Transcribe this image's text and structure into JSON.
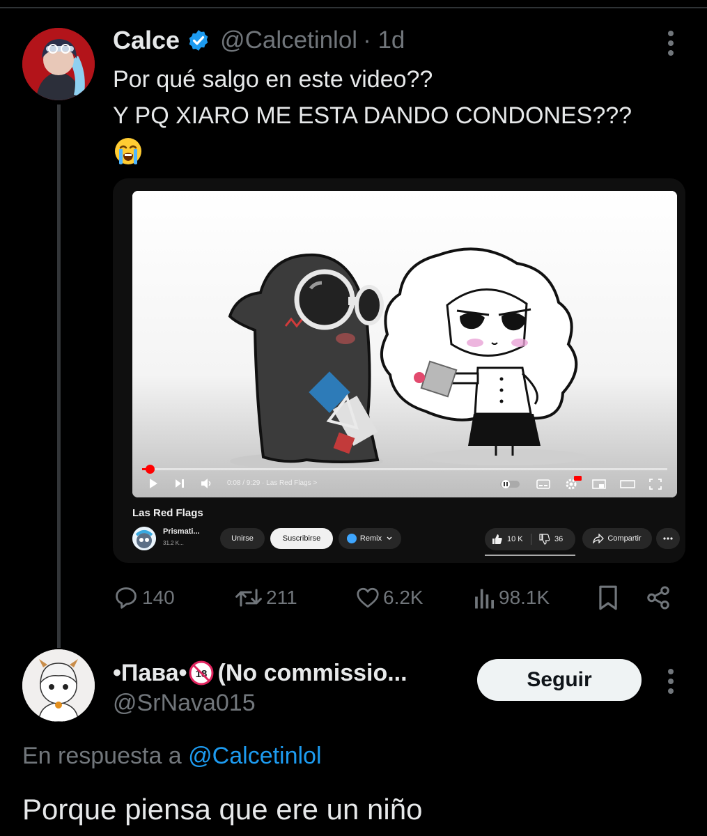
{
  "tweet": {
    "display_name": "Calce",
    "handle": "@Calcetinlol",
    "time": "· 1d",
    "line1": "Por qué salgo en este video??",
    "line2": "Y PQ XIARO ME ESTA DANDO CONDONES???",
    "emoji": "loudly-crying-face-emoji"
  },
  "video_card": {
    "title": "Las Red Flags",
    "time_display": "0:08 / 9:29",
    "chapter": "· Las Red Flags >",
    "progress": 0.015,
    "channel_name": "Prismati...",
    "channel_subs": "31.2 K...",
    "join_label": "Unirse",
    "subscribe_label": "Suscribirse",
    "remix_label": "Remix",
    "likes": "10 K",
    "dislikes": "36",
    "share_label": "Compartir"
  },
  "actions": {
    "replies": "140",
    "reposts": "211",
    "likes": "6.2K",
    "views": "98.1K"
  },
  "reply": {
    "display_name_prefix": "•Пава•",
    "display_name_suffix": "(No commissio...",
    "handle": "@SrNava015",
    "follow_label": "Seguir",
    "replying_prefix": "En respuesta a",
    "replying_to": "@Calcetinlol",
    "text": "Porque piensa que ere un niño"
  },
  "colors": {
    "background": "#000000",
    "text": "#e7e9ea",
    "secondary": "#71767b",
    "accent": "#1d9bf0",
    "youtube_red": "#ff0000"
  }
}
